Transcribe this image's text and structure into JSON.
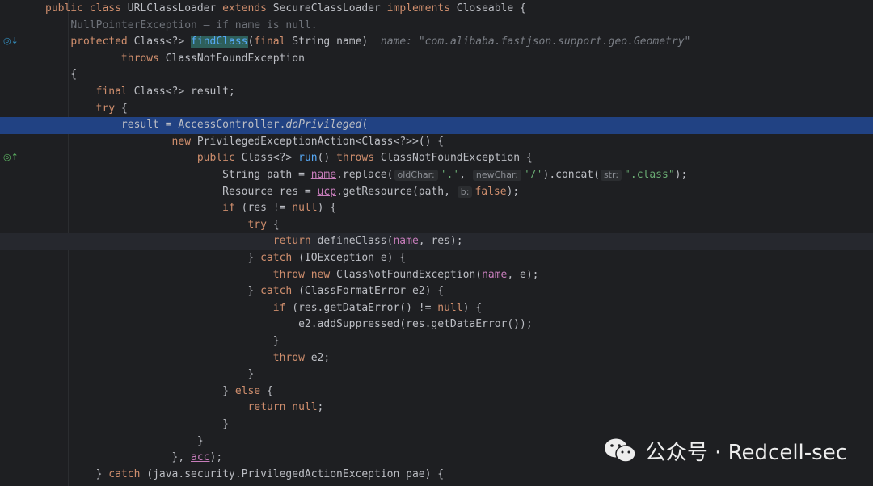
{
  "lines": [
    {
      "id": "l0",
      "parts": [
        {
          "t": "public class ",
          "c": "kw"
        },
        {
          "t": "URLClassLoader "
        },
        {
          "t": "extends ",
          "c": "kw"
        },
        {
          "t": "SecureClassLoader "
        },
        {
          "t": "implements ",
          "c": "kw"
        },
        {
          "t": "Closeable {"
        }
      ]
    },
    {
      "id": "l1",
      "parts": [
        {
          "t": "    "
        },
        {
          "t": "NullPointerException – if name is null.",
          "c": "faded"
        }
      ]
    },
    {
      "id": "l2",
      "parts": [
        {
          "t": "    "
        },
        {
          "t": "protected ",
          "c": "kw"
        },
        {
          "t": "Class<?> "
        },
        {
          "t": "findClass",
          "c": "hl-fn"
        },
        {
          "t": "("
        },
        {
          "t": "final ",
          "c": "kw"
        },
        {
          "t": "String name)  "
        },
        {
          "t": "name: \"com.alibaba.fastjson.support.geo.Geometry\"",
          "c": "hint-inline"
        }
      ]
    },
    {
      "id": "l3",
      "parts": [
        {
          "t": "            "
        },
        {
          "t": "throws ",
          "c": "kw"
        },
        {
          "t": "ClassNotFoundException"
        }
      ]
    },
    {
      "id": "l4",
      "parts": [
        {
          "t": "    {"
        }
      ]
    },
    {
      "id": "l5",
      "parts": [
        {
          "t": "        "
        },
        {
          "t": "final ",
          "c": "kw"
        },
        {
          "t": "Class<?> result;"
        }
      ]
    },
    {
      "id": "l6",
      "parts": [
        {
          "t": "        "
        },
        {
          "t": "try ",
          "c": "kw"
        },
        {
          "t": "{"
        }
      ]
    },
    {
      "id": "l7",
      "sel": true,
      "parts": [
        {
          "t": "            result = AccessController."
        },
        {
          "t": "doPrivileged",
          "c": "it"
        },
        {
          "t": "("
        }
      ]
    },
    {
      "id": "l8",
      "parts": [
        {
          "t": "                    "
        },
        {
          "t": "new ",
          "c": "kw"
        },
        {
          "t": "PrivilegedExceptionAction<Class<?>>() {"
        }
      ]
    },
    {
      "id": "l9",
      "parts": [
        {
          "t": "                        "
        },
        {
          "t": "public ",
          "c": "kw"
        },
        {
          "t": "Class<?> "
        },
        {
          "t": "run",
          "c": "fn"
        },
        {
          "t": "() "
        },
        {
          "t": "throws ",
          "c": "kw"
        },
        {
          "t": "ClassNotFoundException {"
        }
      ]
    },
    {
      "id": "l10",
      "parts": [
        {
          "t": "                            String path = "
        },
        {
          "t": "name",
          "c": "param-ref"
        },
        {
          "t": ".replace("
        },
        {
          "t": "oldChar:",
          "c": "hint"
        },
        {
          "t": "'.'",
          "c": "str"
        },
        {
          "t": ", "
        },
        {
          "t": "newChar:",
          "c": "hint"
        },
        {
          "t": "'/'",
          "c": "str"
        },
        {
          "t": ").concat("
        },
        {
          "t": "str:",
          "c": "hint"
        },
        {
          "t": "\".class\"",
          "c": "str"
        },
        {
          "t": ");"
        }
      ]
    },
    {
      "id": "l11",
      "parts": [
        {
          "t": "                            Resource res = "
        },
        {
          "t": "ucp",
          "c": "param-ref"
        },
        {
          "t": ".getResource(path, "
        },
        {
          "t": "b:",
          "c": "hint"
        },
        {
          "t": "false",
          "c": "kw"
        },
        {
          "t": ");"
        }
      ]
    },
    {
      "id": "l12",
      "parts": [
        {
          "t": "                            "
        },
        {
          "t": "if ",
          "c": "kw"
        },
        {
          "t": "(res != "
        },
        {
          "t": "null",
          "c": "kw"
        },
        {
          "t": ") {"
        }
      ]
    },
    {
      "id": "l13",
      "parts": [
        {
          "t": "                                "
        },
        {
          "t": "try ",
          "c": "kw"
        },
        {
          "t": "{"
        }
      ]
    },
    {
      "id": "l14",
      "caret": true,
      "parts": [
        {
          "t": "                                    "
        },
        {
          "t": "return ",
          "c": "kw"
        },
        {
          "t": "defineClass("
        },
        {
          "t": "name",
          "c": "param-ref"
        },
        {
          "t": ", res);"
        }
      ]
    },
    {
      "id": "l15",
      "parts": [
        {
          "t": "                                } "
        },
        {
          "t": "catch ",
          "c": "kw"
        },
        {
          "t": "(IOException e) {"
        }
      ]
    },
    {
      "id": "l16",
      "parts": [
        {
          "t": "                                    "
        },
        {
          "t": "throw new ",
          "c": "kw"
        },
        {
          "t": "ClassNotFoundException("
        },
        {
          "t": "name",
          "c": "param-ref"
        },
        {
          "t": ", e);"
        }
      ]
    },
    {
      "id": "l17",
      "parts": [
        {
          "t": "                                } "
        },
        {
          "t": "catch ",
          "c": "kw"
        },
        {
          "t": "(ClassFormatError e2) {"
        }
      ]
    },
    {
      "id": "l18",
      "parts": [
        {
          "t": "                                    "
        },
        {
          "t": "if ",
          "c": "kw"
        },
        {
          "t": "(res.getDataError() != "
        },
        {
          "t": "null",
          "c": "kw"
        },
        {
          "t": ") {"
        }
      ]
    },
    {
      "id": "l19",
      "parts": [
        {
          "t": "                                        e2.addSuppressed(res.getDataError());"
        }
      ]
    },
    {
      "id": "l20",
      "parts": [
        {
          "t": "                                    }"
        }
      ]
    },
    {
      "id": "l21",
      "parts": [
        {
          "t": "                                    "
        },
        {
          "t": "throw ",
          "c": "kw"
        },
        {
          "t": "e2;"
        }
      ]
    },
    {
      "id": "l22",
      "parts": [
        {
          "t": "                                }"
        }
      ]
    },
    {
      "id": "l23",
      "parts": [
        {
          "t": "                            } "
        },
        {
          "t": "else ",
          "c": "kw"
        },
        {
          "t": "{"
        }
      ]
    },
    {
      "id": "l24",
      "parts": [
        {
          "t": "                                "
        },
        {
          "t": "return null",
          "c": "kw"
        },
        {
          "t": ";"
        }
      ]
    },
    {
      "id": "l25",
      "parts": [
        {
          "t": "                            }"
        }
      ]
    },
    {
      "id": "l26",
      "parts": [
        {
          "t": "                        }"
        }
      ]
    },
    {
      "id": "l27",
      "parts": [
        {
          "t": "                    }, "
        },
        {
          "t": "acc",
          "c": "param-ref"
        },
        {
          "t": ");"
        }
      ]
    },
    {
      "id": "l28",
      "parts": [
        {
          "t": "        } "
        },
        {
          "t": "catch ",
          "c": "kw"
        },
        {
          "t": "(java.security.PrivilegedActionException pae) {"
        }
      ]
    }
  ],
  "gutter_icons": [
    {
      "name": "override-method-icon",
      "glyph": "◎↓",
      "line": 2,
      "color": "#3592c4"
    },
    {
      "name": "implements-method-icon",
      "glyph": "◎↑",
      "line": 9,
      "color": "#5fb865"
    }
  ],
  "watermark": {
    "text": "公众号 · Redcell-sec"
  }
}
